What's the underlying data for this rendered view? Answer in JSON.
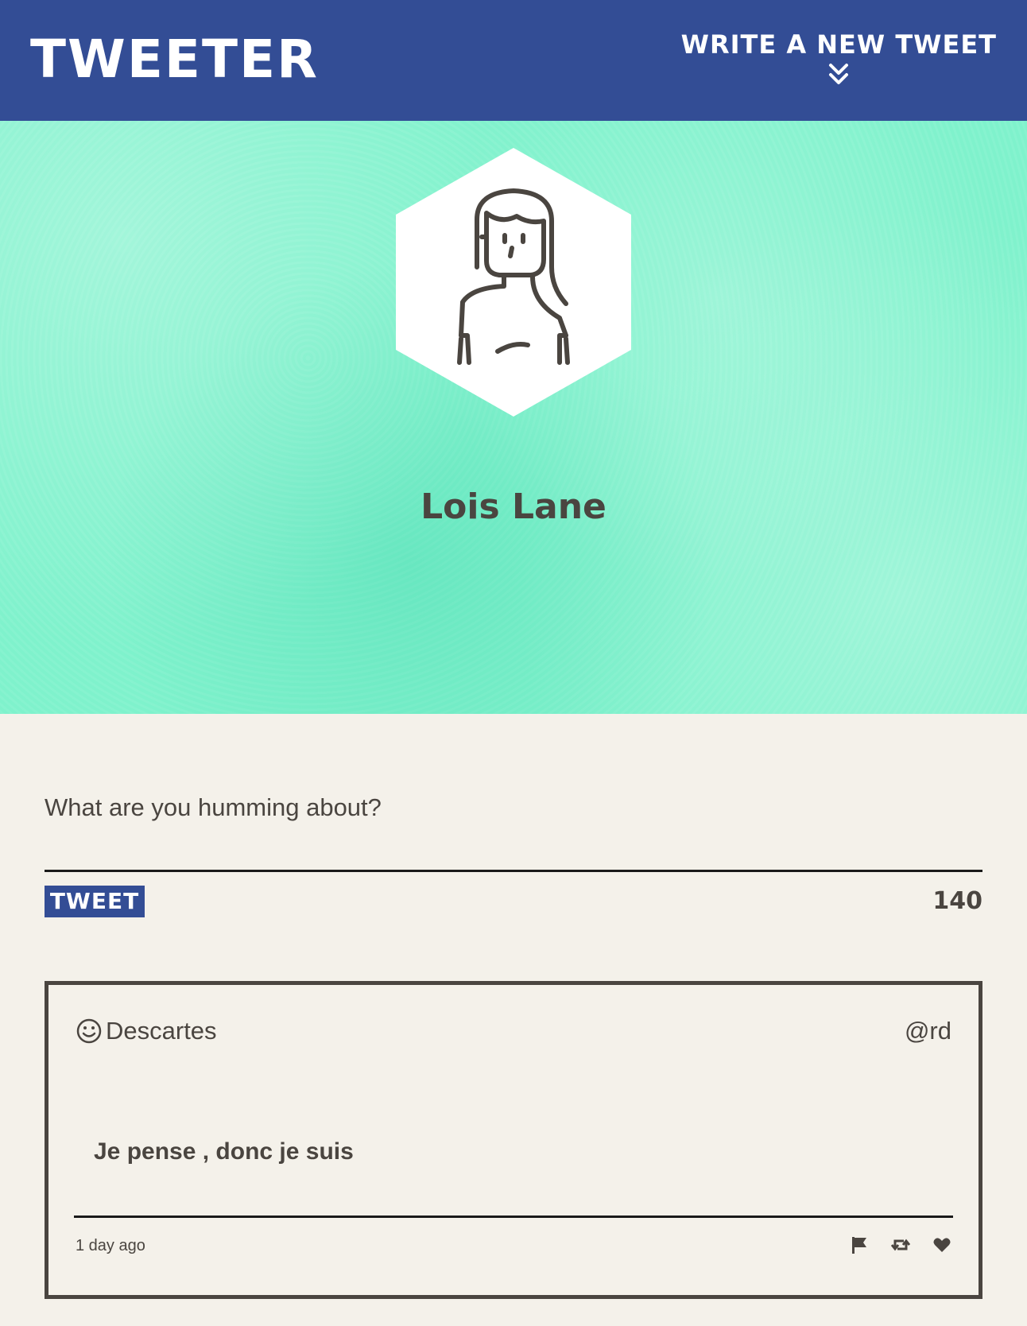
{
  "nav": {
    "brand": "TWEETER",
    "compose_toggle_label": "WRITE A NEW TWEET",
    "compose_toggle_icon": "double-chevron-down-icon"
  },
  "profile": {
    "name": "Lois Lane",
    "avatar_icon": "woman-avatar-icon"
  },
  "compose": {
    "placeholder": "What are you humming about?",
    "value": "",
    "submit_label": "TWEET",
    "char_counter": "140"
  },
  "tweets": [
    {
      "author_name": "Descartes",
      "author_icon": "smiley-icon",
      "handle": "@rd",
      "text": "Je pense , donc je suis",
      "timestamp": "1 day ago",
      "actions": [
        "flag-icon",
        "retweet-icon",
        "heart-icon"
      ]
    }
  ],
  "colors": {
    "nav_bg": "#334d95",
    "header_bg": "#7ff2cc",
    "page_bg": "#f4f1ea",
    "text": "#4a4540"
  }
}
